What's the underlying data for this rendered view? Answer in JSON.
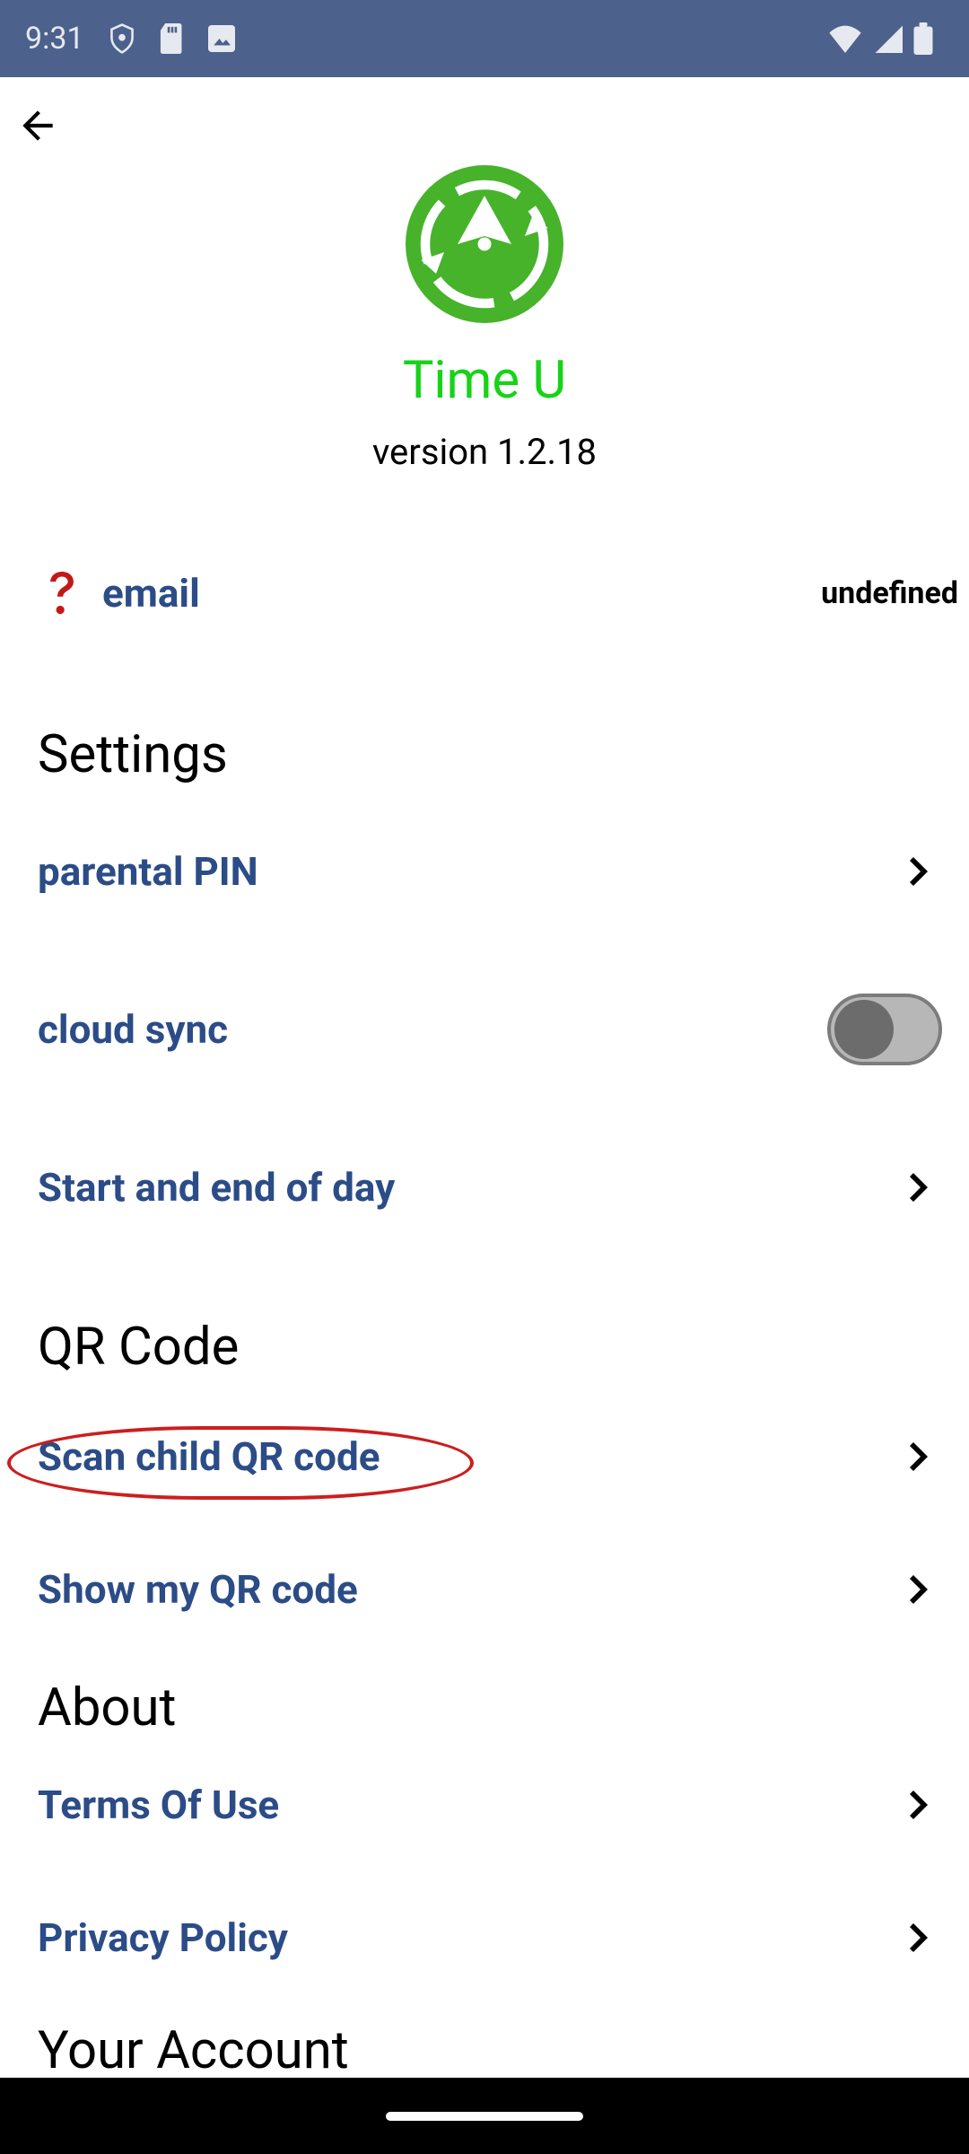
{
  "status_bar": {
    "time": "9:31"
  },
  "header": {
    "app_name": "Time U",
    "version_text": "version 1.2.18"
  },
  "email_row": {
    "label": "email",
    "value": "undefined"
  },
  "sections": {
    "settings": {
      "title": "Settings",
      "parental_pin": "parental PIN",
      "cloud_sync": "cloud sync",
      "cloud_sync_on": false,
      "day_bounds": "Start and end of day"
    },
    "qr": {
      "title": "QR Code",
      "scan_child": "Scan child QR code",
      "show_mine": "Show my QR code"
    },
    "about": {
      "title": "About",
      "terms": "Terms Of Use",
      "privacy": "Privacy Policy"
    },
    "account": {
      "title": "Your Account"
    }
  },
  "colors": {
    "status_bar_bg": "#4c618b",
    "link_text": "#2b4c87",
    "app_title": "#17d318",
    "logo_bg": "#46b32b",
    "highlight_ring": "#cc1e1e"
  }
}
